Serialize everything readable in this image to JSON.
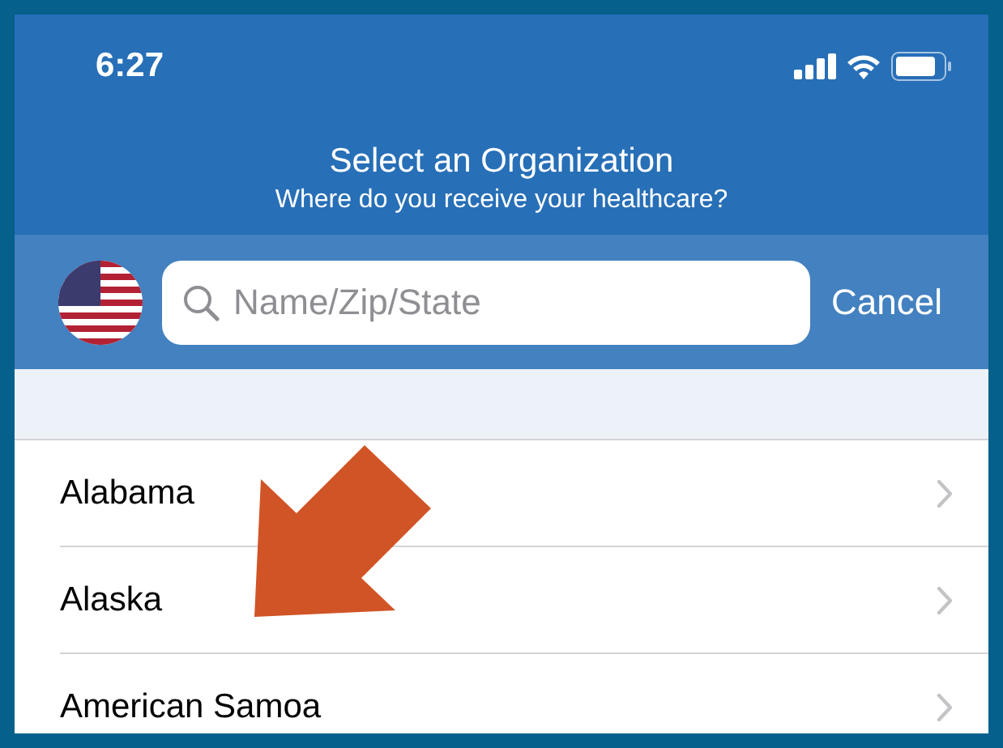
{
  "status_bar": {
    "time": "6:27"
  },
  "header": {
    "title": "Select an Organization",
    "subtitle": "Where do you receive your healthcare?"
  },
  "search": {
    "placeholder": "Name/Zip/State",
    "cancel": "Cancel"
  },
  "rows": [
    {
      "label": "Alabama"
    },
    {
      "label": "Alaska"
    },
    {
      "label": "American Samoa"
    }
  ]
}
